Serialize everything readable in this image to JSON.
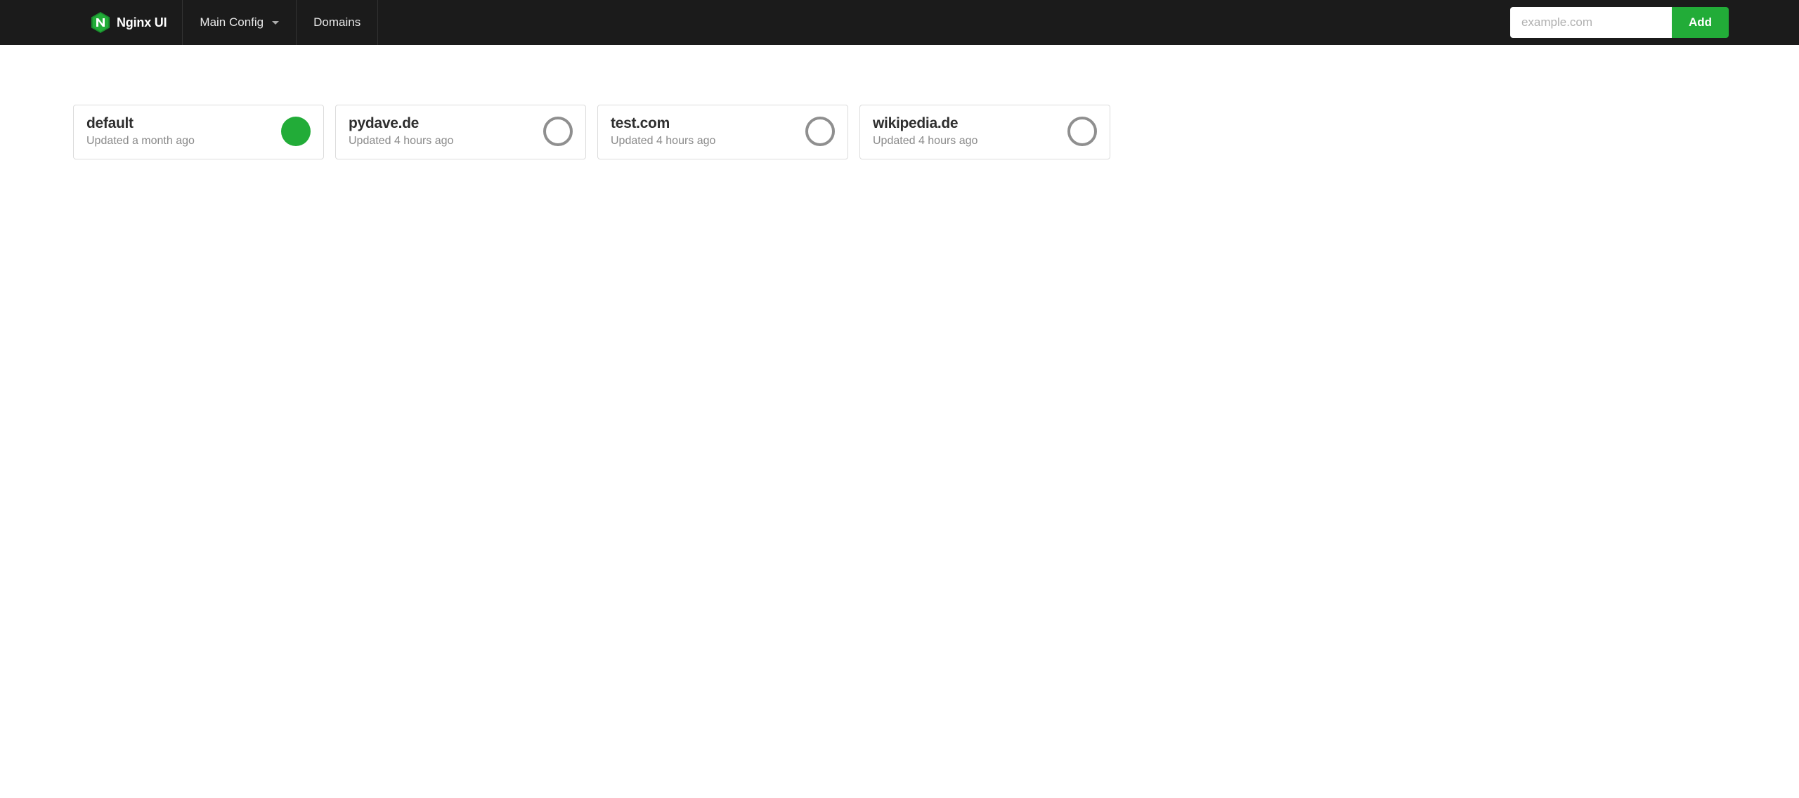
{
  "brand": {
    "name": "Nginx UI"
  },
  "nav": {
    "main_config_label": "Main Config",
    "domains_label": "Domains"
  },
  "add": {
    "placeholder": "example.com",
    "button_label": "Add"
  },
  "domains": [
    {
      "name": "default",
      "updated": "Updated a month ago",
      "status": "enabled"
    },
    {
      "name": "pydave.de",
      "updated": "Updated 4 hours ago",
      "status": "disabled"
    },
    {
      "name": "test.com",
      "updated": "Updated 4 hours ago",
      "status": "disabled"
    },
    {
      "name": "wikipedia.de",
      "updated": "Updated 4 hours ago",
      "status": "disabled"
    }
  ]
}
